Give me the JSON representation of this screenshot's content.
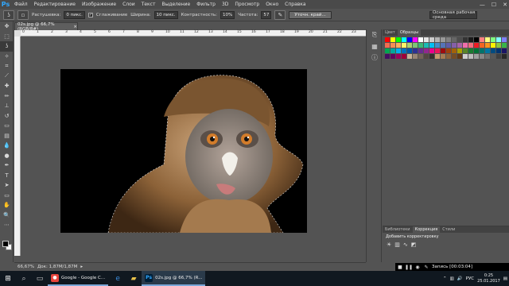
{
  "app": {
    "logo": "Ps"
  },
  "menu": [
    "Файл",
    "Редактирование",
    "Изображение",
    "Слои",
    "Текст",
    "Выделение",
    "Фильтр",
    "3D",
    "Просмотр",
    "Окно",
    "Справка"
  ],
  "options": {
    "feather_label": "Растушевка:",
    "feather_value": "0 пикс.",
    "antialias_label": "Сглаживание",
    "width_label": "Ширина:",
    "width_value": "10 пикс.",
    "contrast_label": "Контрастность:",
    "contrast_value": "10%",
    "frequency_label": "Частота:",
    "frequency_value": "57",
    "refine_button": "Уточн. край...",
    "workspace": "Основная рабочая среда"
  },
  "document": {
    "tab_title": "02s.jpg @ 66,7% (RGB/8#)",
    "zoom": "66,67%",
    "doc_info": "Док: 1,87M/1,87M"
  },
  "rulers": {
    "h_ticks": [
      "0",
      "1",
      "2",
      "3",
      "4",
      "5",
      "6",
      "7",
      "8",
      "9",
      "10",
      "11",
      "12",
      "13",
      "14",
      "15",
      "16",
      "17",
      "18",
      "19",
      "20",
      "21",
      "22",
      "23"
    ]
  },
  "panels": {
    "color_tab": "Цвет",
    "swatches_tab": "Образцы",
    "libraries_tab": "Библиотеки",
    "adjustments_tab": "Коррекция",
    "styles_tab": "Стили",
    "adjust_title": "Добавить корректировку"
  },
  "recorder": {
    "text": "Запись [00:03:04]"
  },
  "taskbar": {
    "app_chrome": "Google - Google C...",
    "app_ps": "02s.jpg @ 66,7% (R...",
    "lang": "РУС",
    "time": "0:25",
    "date": "25.01.2017"
  },
  "colors": {
    "accent": "#31a8ff",
    "taskbar": "#101820"
  }
}
